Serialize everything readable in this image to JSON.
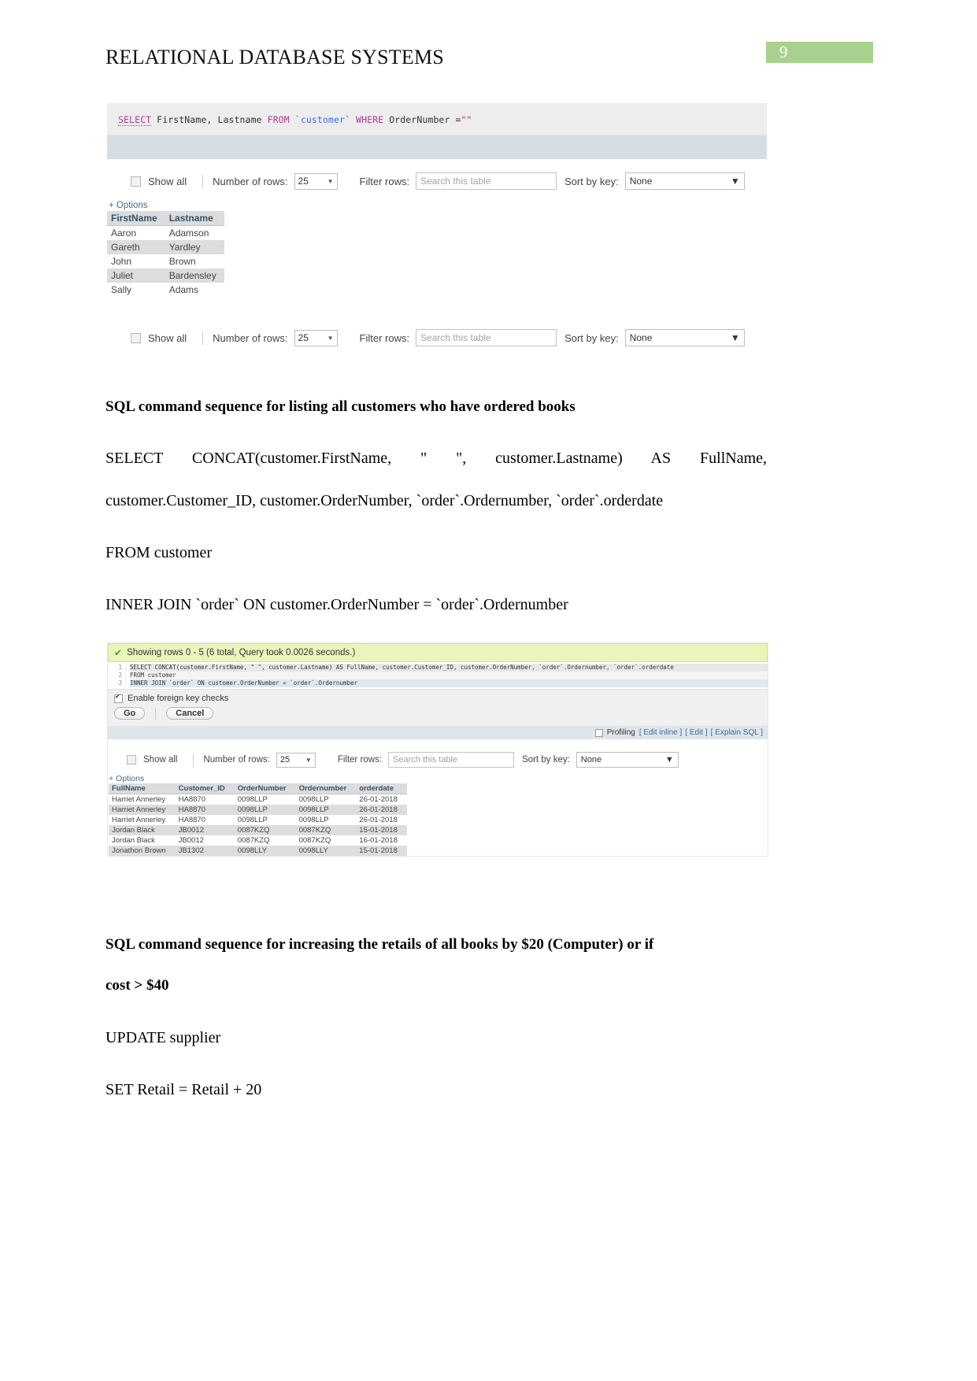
{
  "header": {
    "title": "RELATIONAL DATABASE SYSTEMS",
    "page_number": "9",
    "page_number_bg": "#a9d18e"
  },
  "screenshot1": {
    "sql": {
      "kw_select": "SELECT",
      "fields": " FirstName, Lastname ",
      "kw_from": "FROM",
      "table": " `customer` ",
      "kw_where": "WHERE",
      "cond": " OrderNumber =",
      "value": "\"\""
    },
    "controls_top": {
      "show_all": "Show all",
      "number_of_rows_label": "Number of rows:",
      "number_of_rows_value": "25",
      "filter_rows_label": "Filter rows:",
      "filter_placeholder": "Search this table",
      "sort_by_key_label": "Sort by key:",
      "sort_by_key_value": "None"
    },
    "options_link": "+ Options",
    "table": {
      "columns": [
        "FirstName",
        "Lastname"
      ],
      "rows": [
        [
          "Aaron",
          "Adamson"
        ],
        [
          "Gareth",
          "Yardley"
        ],
        [
          "John",
          "Brown"
        ],
        [
          "Juliet",
          "Bardensley"
        ],
        [
          "Sally",
          "Adams"
        ]
      ]
    },
    "controls_bottom": {
      "show_all": "Show all",
      "number_of_rows_label": "Number of rows:",
      "number_of_rows_value": "25",
      "filter_rows_label": "Filter rows:",
      "filter_placeholder": "Search this table",
      "sort_by_key_label": "Sort by key:",
      "sort_by_key_value": "None"
    }
  },
  "section1": {
    "heading": "SQL command sequence for listing all customers who have ordered books",
    "line1": "SELECT   CONCAT(customer.FirstName,   \"   \",   customer.Lastname)   AS   FullName,",
    "line2": "customer.Customer_ID, customer.OrderNumber, `order`.Ordernumber, `order`.orderdate",
    "line3": "FROM customer",
    "line4": "INNER JOIN `order` ON customer.OrderNumber = `order`.Ordernumber"
  },
  "screenshot2": {
    "success_message": "Showing rows 0 - 5 (6 total, Query took 0.0026 seconds.)",
    "code_lines": [
      "SELECT CONCAT(customer.FirstName, \" \", customer.Lastname) AS FullName, customer.Customer_ID, customer.OrderNumber, `order`.Ordernumber, `order`.orderdate",
      "FROM customer",
      "INNER JOIN `order` ON customer.OrderNumber = `order`.Ordernumber"
    ],
    "line_numbers": [
      "1",
      "2",
      "3"
    ],
    "foreign_key_label": "Enable foreign key checks",
    "go_button": "Go",
    "cancel_button": "Cancel",
    "profiling_label": "Profiling",
    "edit_inline_link": "[ Edit inline ]",
    "edit_link": "[ Edit ]",
    "explain_sql_link": "[ Explain SQL ]",
    "controls": {
      "show_all": "Show all",
      "number_of_rows_label": "Number of rows:",
      "number_of_rows_value": "25",
      "filter_rows_label": "Filter rows:",
      "filter_placeholder": "Search this table",
      "sort_by_key_label": "Sort by key:",
      "sort_by_key_value": "None"
    },
    "options_link": "+ Options",
    "table": {
      "columns": [
        "FullName",
        "Customer_ID",
        "OrderNumber",
        "Ordernumber",
        "orderdate"
      ],
      "rows": [
        [
          "Harriet Annerley",
          "HA8870",
          "0098LLP",
          "0098LLP",
          "26-01-2018"
        ],
        [
          "Harriet Annerley",
          "HA8870",
          "0098LLP",
          "0098LLP",
          "26-01-2018"
        ],
        [
          "Harriet Annerley",
          "HA8870",
          "0098LLP",
          "0098LLP",
          "26-01-2018"
        ],
        [
          "Jordan Black",
          "JB0012",
          "0087KZQ",
          "0087KZQ",
          "15-01-2018"
        ],
        [
          "Jordan Black",
          "JB0012",
          "0087KZQ",
          "0087KZQ",
          "16-01-2018"
        ],
        [
          "Jonathon Brown",
          "JB1302",
          "0098LLY",
          "0098LLY",
          "15-01-2018"
        ]
      ]
    }
  },
  "section2": {
    "heading_line1": "SQL command sequence for increasing the retails of all books by $20 (Computer) or if",
    "heading_line2": "cost > $40",
    "line1": "UPDATE supplier",
    "line2": "SET Retail = Retail + 20"
  }
}
